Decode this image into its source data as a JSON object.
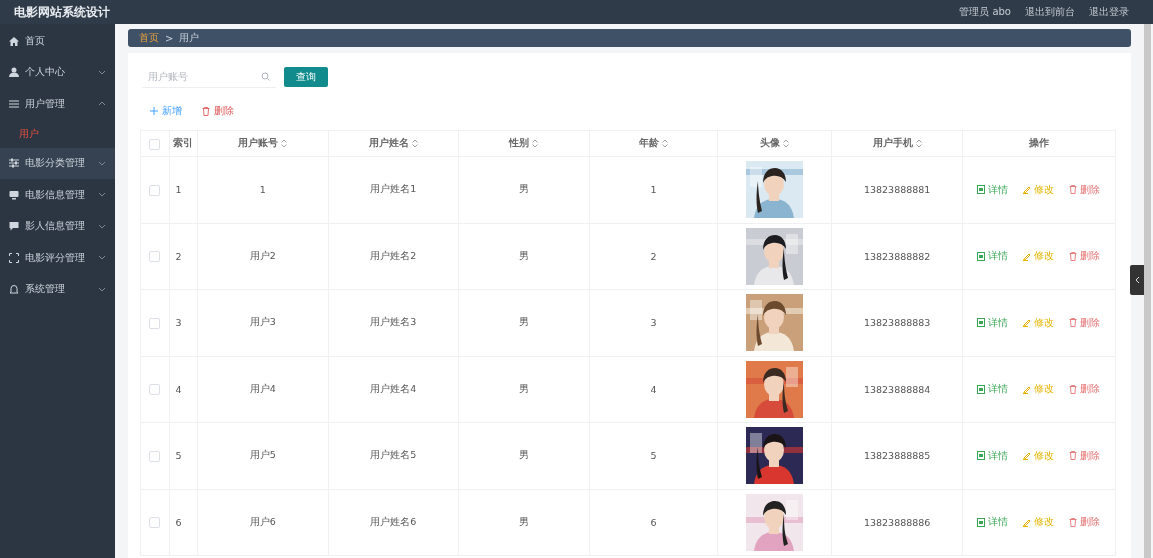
{
  "header": {
    "title": "电影网站系统设计",
    "links": [
      "管理员 abo",
      "退出到前台",
      "退出登录"
    ]
  },
  "sidebar": {
    "items": [
      {
        "label": "首页",
        "hovered": false
      },
      {
        "label": "个人中心",
        "expanded": false,
        "hovered": false
      },
      {
        "label": "用户管理",
        "expanded": true,
        "hovered": false,
        "children": [
          {
            "label": "用户",
            "selected": true
          }
        ]
      },
      {
        "label": "电影分类管理",
        "expanded": false,
        "hovered": true
      },
      {
        "label": "电影信息管理",
        "expanded": false,
        "hovered": false
      },
      {
        "label": "影人信息管理",
        "expanded": false,
        "hovered": false
      },
      {
        "label": "电影评分管理",
        "expanded": false,
        "hovered": false
      },
      {
        "label": "系统管理",
        "expanded": false,
        "hovered": false
      }
    ]
  },
  "breadcrumb": [
    "首页",
    ">",
    "用户"
  ],
  "search": {
    "placeholder": "用户账号",
    "button": "查询"
  },
  "actions": [
    {
      "kind": "add",
      "label": "新增"
    },
    {
      "kind": "delete",
      "label": "删除"
    }
  ],
  "table": {
    "select_all": {
      "checked": false
    },
    "columns": [
      {
        "label": "索引",
        "sortable": false
      },
      {
        "label": "用户账号",
        "sortable": true
      },
      {
        "label": "用户姓名",
        "sortable": true
      },
      {
        "label": "性别",
        "sortable": true
      },
      {
        "label": "年龄",
        "sortable": true
      },
      {
        "label": "头像",
        "sortable": true
      },
      {
        "label": "用户手机",
        "sortable": true
      },
      {
        "label": "操作",
        "sortable": false
      }
    ],
    "rows": [
      {
        "index": "1",
        "account": "1",
        "name": "用户姓名1",
        "gender": "男",
        "age": "1",
        "phone": "13823888881",
        "checked": false,
        "actions": [
          {
            "kind": "detail",
            "label": "详情"
          },
          {
            "kind": "edit",
            "label": "修改"
          },
          {
            "kind": "delete",
            "label": "删除"
          }
        ]
      },
      {
        "index": "2",
        "account": "用户2",
        "name": "用户姓名2",
        "gender": "男",
        "age": "2",
        "phone": "13823888882",
        "checked": false,
        "actions": [
          {
            "kind": "detail",
            "label": "详情"
          },
          {
            "kind": "edit",
            "label": "修改"
          },
          {
            "kind": "delete",
            "label": "删除"
          }
        ]
      },
      {
        "index": "3",
        "account": "用户3",
        "name": "用户姓名3",
        "gender": "男",
        "age": "3",
        "phone": "13823888883",
        "checked": false,
        "actions": [
          {
            "kind": "detail",
            "label": "详情"
          },
          {
            "kind": "edit",
            "label": "修改"
          },
          {
            "kind": "delete",
            "label": "删除"
          }
        ]
      },
      {
        "index": "4",
        "account": "用户4",
        "name": "用户姓名4",
        "gender": "男",
        "age": "4",
        "phone": "13823888884",
        "checked": false,
        "actions": [
          {
            "kind": "detail",
            "label": "详情"
          },
          {
            "kind": "edit",
            "label": "修改"
          },
          {
            "kind": "delete",
            "label": "删除"
          }
        ]
      },
      {
        "index": "5",
        "account": "用户5",
        "name": "用户姓名5",
        "gender": "男",
        "age": "5",
        "phone": "13823888885",
        "checked": false,
        "actions": [
          {
            "kind": "detail",
            "label": "详情"
          },
          {
            "kind": "edit",
            "label": "修改"
          },
          {
            "kind": "delete",
            "label": "删除"
          }
        ]
      },
      {
        "index": "6",
        "account": "用户6",
        "name": "用户姓名6",
        "gender": "男",
        "age": "6",
        "phone": "13823888886",
        "checked": false,
        "actions": [
          {
            "kind": "detail",
            "label": "详情"
          },
          {
            "kind": "edit",
            "label": "修改"
          },
          {
            "kind": "delete",
            "label": "删除"
          }
        ]
      }
    ]
  }
}
